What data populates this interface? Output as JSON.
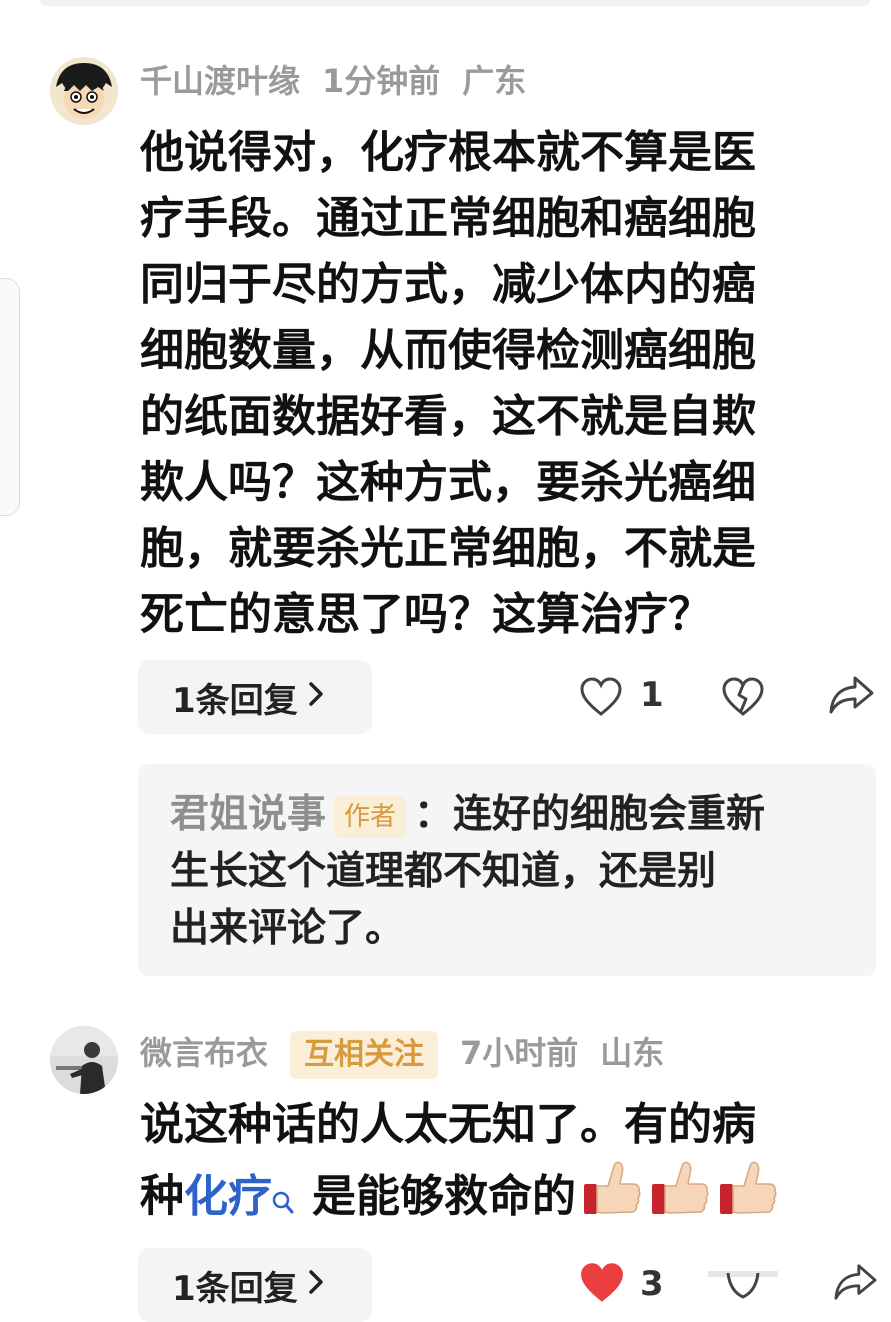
{
  "comment1": {
    "username": "千山渡叶缘",
    "time": "1分钟前",
    "location": "广东",
    "lines": [
      "他说得对，化疗根本就不算是医",
      "疗手段。通过正常细胞和癌细胞",
      "同归于尽的方式，减少体内的癌",
      "细胞数量，从而使得检测癌细胞",
      "的纸面数据好看，这不就是自欺",
      "欺人吗？这种方式，要杀光癌细",
      "胞，就要杀光正常细胞，不就是",
      "死亡的意思了吗？这算治疗？"
    ],
    "reply_button": "1条回复",
    "like_count": "1",
    "like_icon": "heart-outline-icon",
    "dislike_icon": "broken-heart-icon",
    "share_icon": "share-icon"
  },
  "reply_quote": {
    "author": "君姐说事",
    "author_tag": "作者",
    "separator": "：",
    "line1": "连好的细胞会重新",
    "line2": "生长这个道理都不知道，还是别",
    "line3": "出来评论了。"
  },
  "comment2": {
    "username": "微言布衣",
    "tag": "互相关注",
    "time": "7小时前",
    "location": "山东",
    "line1": "说这种话的人太无知了。有的病",
    "line2_prefix": "种",
    "line2_link": "化疗",
    "line2_suffix": "是能够救命的",
    "reply_button": "1条回复",
    "like_count": "3",
    "like_icon": "heart-filled-icon",
    "thumbs": [
      "thumbs-up-emoji",
      "thumbs-up-emoji",
      "thumbs-up-emoji"
    ]
  },
  "colors": {
    "meta_gray": "#9a9a9a",
    "tag_bg": "#fbeed9",
    "tag_text": "#d79a3c",
    "link_blue": "#2d63c8",
    "like_red": "#e9403f"
  }
}
